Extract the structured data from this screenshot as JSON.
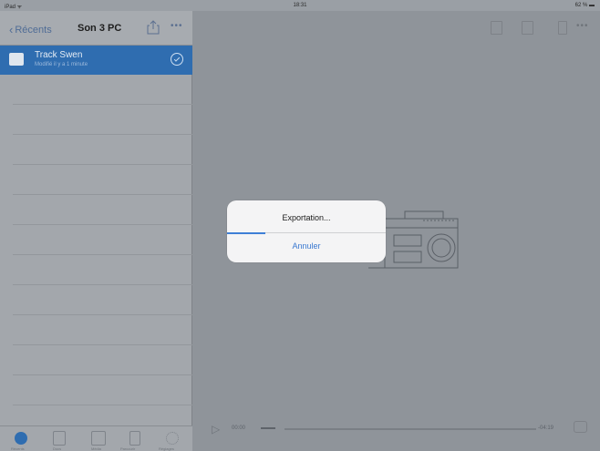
{
  "statusbar": {
    "carrier": "iPad ᯤ",
    "time": "18:31",
    "battery": "62 % ▬"
  },
  "sidebar": {
    "back_label": "Récents",
    "title": "Son 3 PC",
    "more_label": "•••",
    "track": {
      "name": "Track Swen",
      "subtitle": "Modifié il y a 1 minute"
    },
    "tabs": [
      {
        "icon": "recents-icon",
        "label": "Récents"
      },
      {
        "icon": "document-icon",
        "label": "Docs"
      },
      {
        "icon": "media-icon",
        "label": "Média"
      },
      {
        "icon": "browse-icon",
        "label": "Parcourir"
      },
      {
        "icon": "settings-icon",
        "label": "Réglages"
      }
    ]
  },
  "main": {
    "more_label": "•••",
    "player": {
      "time_current": "00:00",
      "time_total": "-04:19",
      "progress": 0.0
    }
  },
  "alert": {
    "title": "Exportation...",
    "cancel_label": "Annuler",
    "progress": 0.24
  },
  "colors": {
    "accent": "#3a78d0",
    "selection": "#2f6db0",
    "dim_overlay": "#8f949a"
  }
}
